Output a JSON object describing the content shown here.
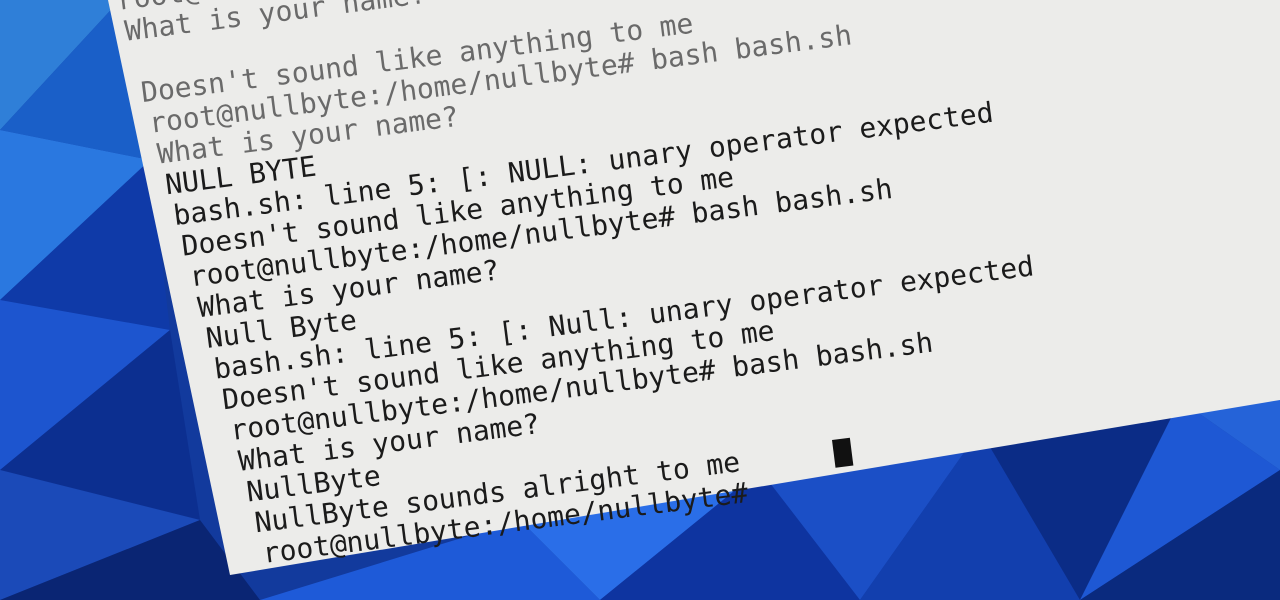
{
  "terminal": {
    "lines": [
      "root@nullbyte:/home/nullbyte",
      "What is your name?",
      "",
      "Doesn't sound like anything to me",
      "root@nullbyte:/home/nullbyte# bash bash.sh",
      "What is your name?",
      "NULL BYTE",
      "bash.sh: line 5: [: NULL: unary operator expected",
      "Doesn't sound like anything to me",
      "root@nullbyte:/home/nullbyte# bash bash.sh",
      "What is your name?",
      "Null Byte",
      "bash.sh: line 5: [: Null: unary operator expected",
      "Doesn't sound like anything to me",
      "root@nullbyte:/home/nullbyte# bash bash.sh",
      "What is your name?",
      "NullByte",
      "NullByte sounds alright to me",
      "root@nullbyte:/home/nullbyte# "
    ]
  },
  "colors": {
    "terminal_background": "#eeeeee",
    "terminal_text": "#1b1b1b",
    "desktop_blue": "#1f56d6"
  }
}
